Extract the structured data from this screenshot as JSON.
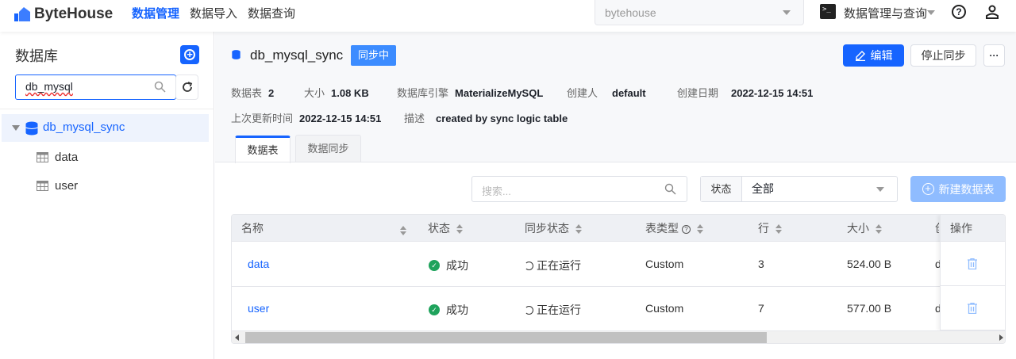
{
  "header": {
    "brand": "ByteHouse",
    "nav": [
      "数据管理",
      "数据导入",
      "数据查询"
    ],
    "workspace": "bytehouse",
    "mode": "数据管理与查询",
    "accent": "#1664ff"
  },
  "sidebar": {
    "title": "数据库",
    "search_value": "db_mysql",
    "tree": {
      "db": "db_mysql_sync",
      "tables": [
        "data",
        "user"
      ]
    }
  },
  "detail": {
    "name": "db_mysql_sync",
    "badge": "同步中",
    "edit": "编辑",
    "stop": "停止同步",
    "more": "···",
    "meta": [
      {
        "label": "数据表",
        "value": "2"
      },
      {
        "label": "大小",
        "value": "1.08 KB"
      },
      {
        "label": "数据库引擎",
        "value": "MaterializeMySQL"
      },
      {
        "label": "创建人",
        "value": "default"
      },
      {
        "label": "创建日期",
        "value": "2022-12-15 14:51"
      },
      {
        "label": "上次更新时间",
        "value": "2022-12-15 14:51"
      },
      {
        "label": "描述",
        "value": "created by sync logic table"
      }
    ],
    "tabs": [
      "数据表",
      "数据同步"
    ]
  },
  "toolbar": {
    "search_placeholder": "搜索...",
    "filter_label": "状态",
    "filter_value": "全部",
    "new_table": "新建数据表"
  },
  "table": {
    "headers": [
      "名称",
      "状态",
      "同步状态",
      "表类型",
      "行",
      "大小",
      "创",
      "操作"
    ],
    "rows": [
      {
        "name": "data",
        "status": "成功",
        "sync": "正在运行",
        "type": "Custom",
        "rows": "3",
        "size": "524.00 B",
        "creator": "d"
      },
      {
        "name": "user",
        "status": "成功",
        "sync": "正在运行",
        "type": "Custom",
        "rows": "7",
        "size": "577.00 B",
        "creator": "d"
      }
    ]
  }
}
